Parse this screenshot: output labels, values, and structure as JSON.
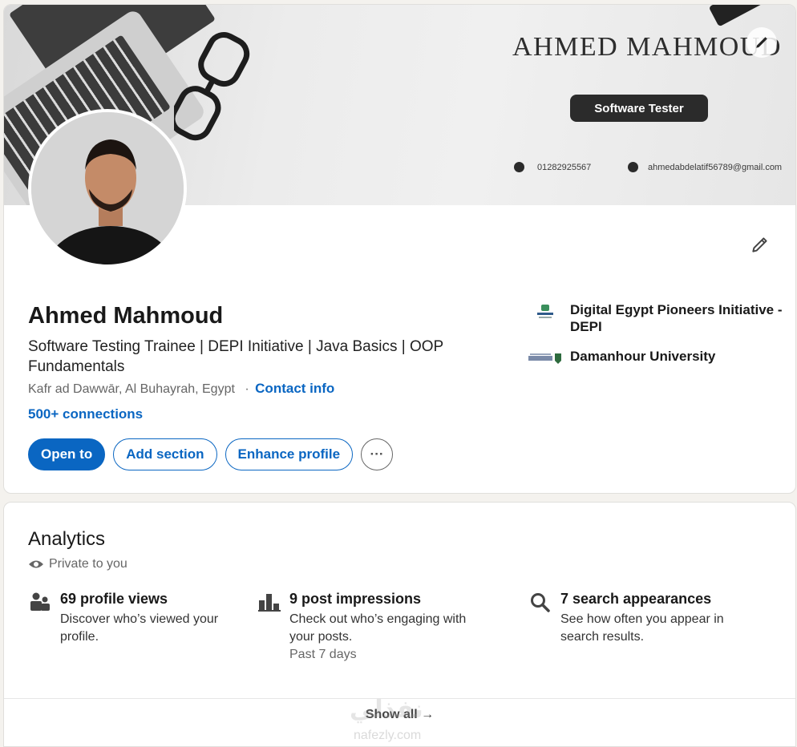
{
  "banner": {
    "name": "AHMED MAHMOUD",
    "role": "Software Tester",
    "phone": "01282925567",
    "email": "ahmedabdelatif56789@gmail.com"
  },
  "profile": {
    "name": "Ahmed Mahmoud",
    "headline": "Software Testing Trainee | DEPI Initiative | Java Basics | OOP Fundamentals",
    "location": "Kafr ad Dawwār, Al Buhayrah, Egypt",
    "separator": "·",
    "contact_info": "Contact info",
    "connections": "500+ connections"
  },
  "actions": {
    "open_to": "Open to",
    "add_section": "Add section",
    "enhance_profile": "Enhance profile",
    "more": "···"
  },
  "side": {
    "items": [
      {
        "label": "Digital Egypt Pioneers Initiative - DEPI",
        "icon": "depi-logo"
      },
      {
        "label": "Damanhour University",
        "icon": "university-logo"
      }
    ]
  },
  "analytics": {
    "title": "Analytics",
    "privacy": "Private to you",
    "metrics": [
      {
        "title": "69 profile views",
        "desc": "Discover who’s viewed your profile.",
        "icon": "people-icon"
      },
      {
        "title": "9 post impressions",
        "desc": "Check out who’s engaging with your posts.",
        "sub": "Past 7 days",
        "icon": "bar-chart-icon"
      },
      {
        "title": "7 search appearances",
        "desc": "See how often you appear in search results.",
        "icon": "search-icon"
      }
    ],
    "show_all": "Show all →"
  },
  "watermark": {
    "line1": "نفذلي",
    "line2": "nafezly.com"
  },
  "colors": {
    "accent": "#0a66c2",
    "text": "#191919",
    "muted": "#666666"
  }
}
